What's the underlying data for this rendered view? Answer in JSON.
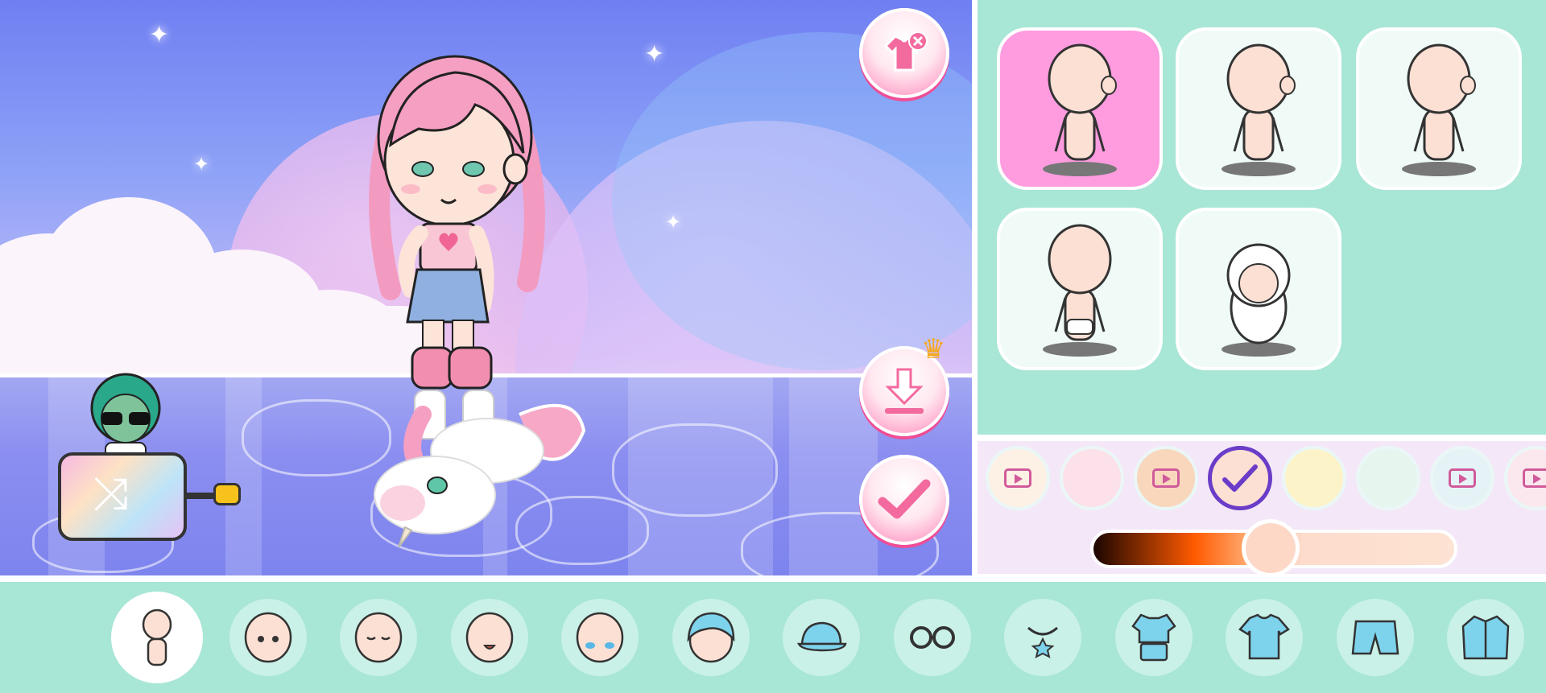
{
  "icons": {
    "remove_outfit": "shirt-remove-icon",
    "download": "download-icon",
    "download_badge": "crown-icon",
    "confirm": "checkmark-icon",
    "shuffle": "shuffle-icon"
  },
  "colors": {
    "accent_pink": "#ff7ab3",
    "panel_mint": "#a8e6d6",
    "selected_card": "#ff9ce0",
    "selected_ring": "#6a3cc8"
  },
  "body_types": [
    {
      "name": "body-type-1",
      "selected": true
    },
    {
      "name": "body-type-2",
      "selected": false
    },
    {
      "name": "body-type-3",
      "selected": false
    },
    {
      "name": "body-type-4",
      "selected": false
    },
    {
      "name": "body-type-5",
      "selected": false
    }
  ],
  "skin_colors": [
    {
      "color": "#fdf1e6",
      "locked_video": true,
      "selected": false
    },
    {
      "color": "#fde1ea",
      "locked_video": false,
      "selected": false
    },
    {
      "color": "#f9d7bd",
      "locked_video": true,
      "selected": false
    },
    {
      "color": "#fde0d4",
      "locked_video": false,
      "selected": true
    },
    {
      "color": "#fdf3c8",
      "locked_video": false,
      "selected": false
    },
    {
      "color": "#e6f6ef",
      "locked_video": false,
      "selected": false
    },
    {
      "color": "#e6f3f6",
      "locked_video": true,
      "selected": false
    },
    {
      "color": "#fbe8ee",
      "locked_video": true,
      "selected": false
    }
  ],
  "skin_tone_slider": {
    "value": 0.49
  },
  "categories": [
    {
      "name": "body",
      "icon": "body-icon",
      "active": true
    },
    {
      "name": "face-eyes",
      "icon": "face-eyes-icon",
      "active": false
    },
    {
      "name": "face-closed-eyes",
      "icon": "face-closed-eyes-icon",
      "active": false
    },
    {
      "name": "face-mouth",
      "icon": "face-mouth-icon",
      "active": false
    },
    {
      "name": "face-blush",
      "icon": "face-blush-icon",
      "active": false
    },
    {
      "name": "hair",
      "icon": "hair-icon",
      "active": false
    },
    {
      "name": "hat",
      "icon": "cap-icon",
      "active": false
    },
    {
      "name": "glasses",
      "icon": "glasses-icon",
      "active": false
    },
    {
      "name": "necklace",
      "icon": "necklace-icon",
      "active": false
    },
    {
      "name": "outfit",
      "icon": "outfit-icon",
      "active": false
    },
    {
      "name": "top",
      "icon": "tshirt-icon",
      "active": false
    },
    {
      "name": "bottom",
      "icon": "shorts-icon",
      "active": false
    },
    {
      "name": "jacket",
      "icon": "jacket-icon",
      "active": false
    }
  ]
}
